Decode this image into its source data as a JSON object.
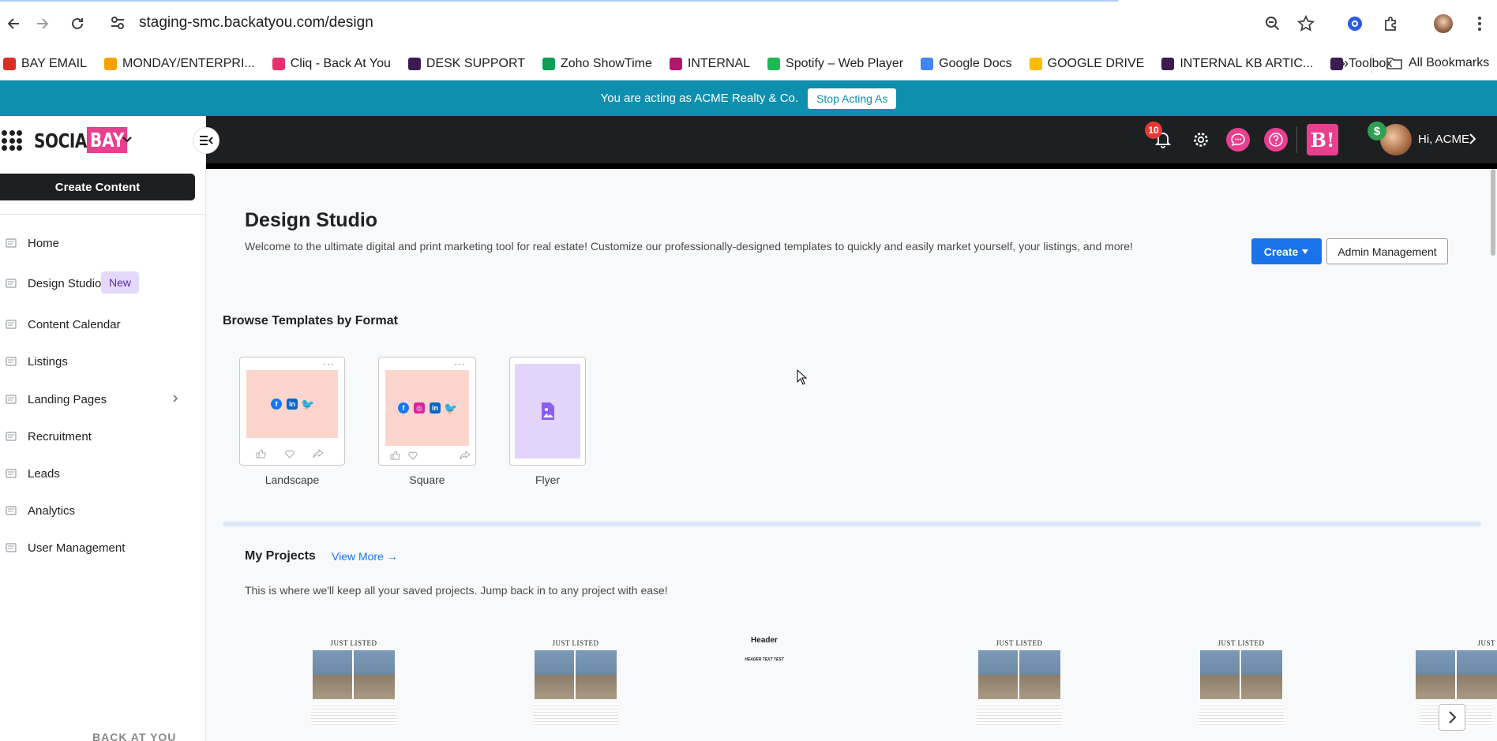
{
  "browser": {
    "url": "staging-smc.backatyou.com/design",
    "bookmarks": [
      {
        "label": "BAY EMAIL",
        "color": "#d93025"
      },
      {
        "label": "MONDAY/ENTERPRI...",
        "color": "#f6a100"
      },
      {
        "label": "Cliq - Back At You",
        "color": "#e8306e"
      },
      {
        "label": "DESK SUPPORT",
        "color": "#3a1c52"
      },
      {
        "label": "Zoho ShowTime",
        "color": "#0f9d58"
      },
      {
        "label": "INTERNAL",
        "color": "#b0186a"
      },
      {
        "label": "Spotify – Web Player",
        "color": "#1db954"
      },
      {
        "label": "Google Docs",
        "color": "#4285f4"
      },
      {
        "label": "GOOGLE  DRIVE",
        "color": "#fbbc04"
      },
      {
        "label": "INTERNAL KB ARTIC...",
        "color": "#3a1c52"
      },
      {
        "label": "Toolbox",
        "color": "#3a1c52"
      }
    ],
    "more_label": "»",
    "all_bookmarks": "All Bookmarks"
  },
  "banner": {
    "text": "You are acting as ACME Realty & Co.",
    "stop_label": "Stop Acting As"
  },
  "sidebar": {
    "logo_social": "SOCIAL",
    "logo_bay": "BAY",
    "create_label": "Create Content",
    "items": [
      {
        "label": "Home",
        "icon": "home-icon"
      },
      {
        "label": "Design Studio",
        "icon": "design-icon",
        "badge": "New"
      },
      {
        "label": "Content Calendar",
        "icon": "calendar-icon"
      },
      {
        "label": "Listings",
        "icon": "listings-icon"
      },
      {
        "label": "Landing Pages",
        "icon": "landing-icon"
      },
      {
        "label": "Recruitment",
        "icon": "recruitment-icon"
      },
      {
        "label": "Leads",
        "icon": "leads-icon"
      },
      {
        "label": "Analytics",
        "icon": "analytics-icon"
      },
      {
        "label": "User Management",
        "icon": "user-management-icon"
      }
    ],
    "footer": "BACK AT YOU"
  },
  "header": {
    "notification_count": "10",
    "greeting": "Hi, ACME",
    "brand_b": "B!",
    "dollar": "$"
  },
  "main": {
    "title": "Design Studio",
    "description": "Welcome to the ultimate digital and print marketing tool for real estate! Customize our professionally-designed templates to quickly and easily market yourself, your listings, and more!",
    "create_label": "Create",
    "admin_label": "Admin Management",
    "browse_title": "Browse Templates by Format",
    "formats": [
      {
        "label": "Landscape"
      },
      {
        "label": "Square"
      },
      {
        "label": "Flyer"
      }
    ],
    "projects_title": "My Projects",
    "view_more": "View More →",
    "projects_desc": "This is where we'll keep all your saved projects. Jump back in to any project with ease!",
    "projects": [
      {
        "kind": "flyer",
        "title": "JUST LISTED"
      },
      {
        "kind": "flyer",
        "title": "JUST LISTED"
      },
      {
        "kind": "header",
        "title": "Header",
        "subtitle": "HEADER TEXT TEST"
      },
      {
        "kind": "flyer",
        "title": "JUST LISTED"
      },
      {
        "kind": "flyer",
        "title": "JUST LISTED"
      },
      {
        "kind": "flyer",
        "title": "JUST"
      }
    ]
  },
  "colors": {
    "accent_blue": "#1a73e8",
    "banner": "#0f8faf",
    "brand_pink": "#e93f8f",
    "header_dark": "#1e1f21"
  }
}
